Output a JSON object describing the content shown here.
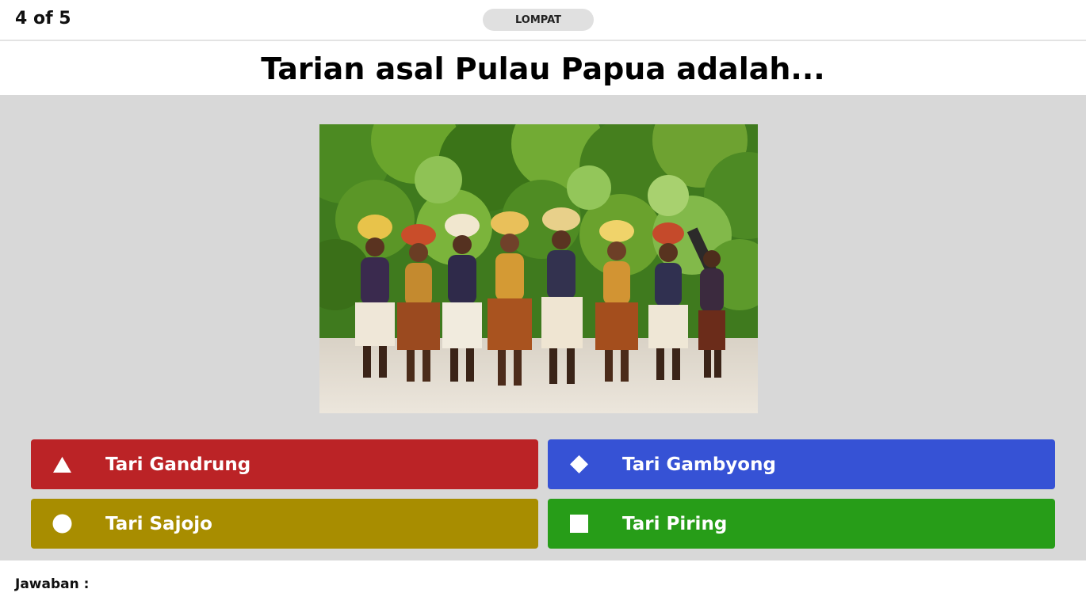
{
  "header": {
    "progress": "4 of 5",
    "skip_label": "LOMPAT"
  },
  "question": {
    "text": "Tarian asal Pulau Papua adalah..."
  },
  "answers": [
    {
      "label": "Tari Gandrung",
      "shape": "triangle-icon",
      "color": "#bb2326"
    },
    {
      "label": "Tari Gambyong",
      "shape": "diamond-icon",
      "color": "#3652d5"
    },
    {
      "label": "Tari Sajojo",
      "shape": "circle-icon",
      "color": "#a88d00"
    },
    {
      "label": "Tari Piring",
      "shape": "square-icon",
      "color": "#279d18"
    }
  ],
  "footer": {
    "answer_label": "Jawaban :"
  }
}
